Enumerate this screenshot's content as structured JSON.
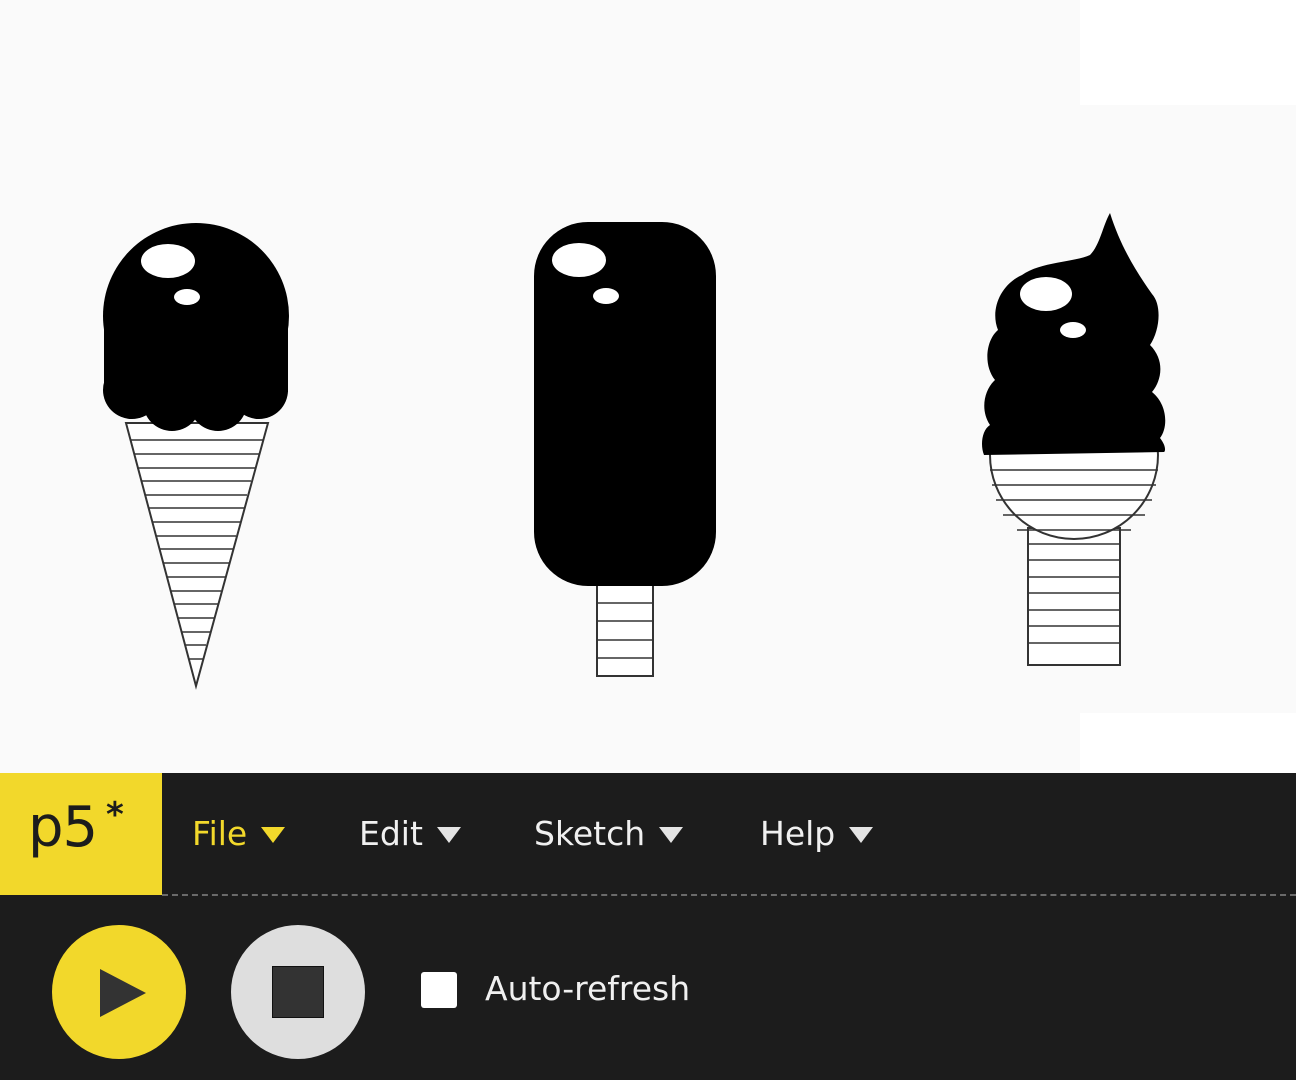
{
  "logo": {
    "text": "p5",
    "star": "*"
  },
  "menu": [
    {
      "label": "File",
      "active": true
    },
    {
      "label": "Edit",
      "active": false
    },
    {
      "label": "Sketch",
      "active": false
    },
    {
      "label": "Help",
      "active": false
    }
  ],
  "controls": {
    "play_icon": "play-icon",
    "stop_icon": "stop-icon",
    "autorefresh_label": "Auto-refresh",
    "autorefresh_checked": false
  },
  "canvas": {
    "items": [
      "scoop-cone-ice-cream",
      "popsicle",
      "soft-serve-ice-cream"
    ]
  },
  "colors": {
    "accent": "#f2d82b",
    "toolbar_bg": "#1c1c1c",
    "canvas_bg": "#fafafa",
    "menu_text": "#f0f0f0",
    "button_icon": "#333333"
  }
}
